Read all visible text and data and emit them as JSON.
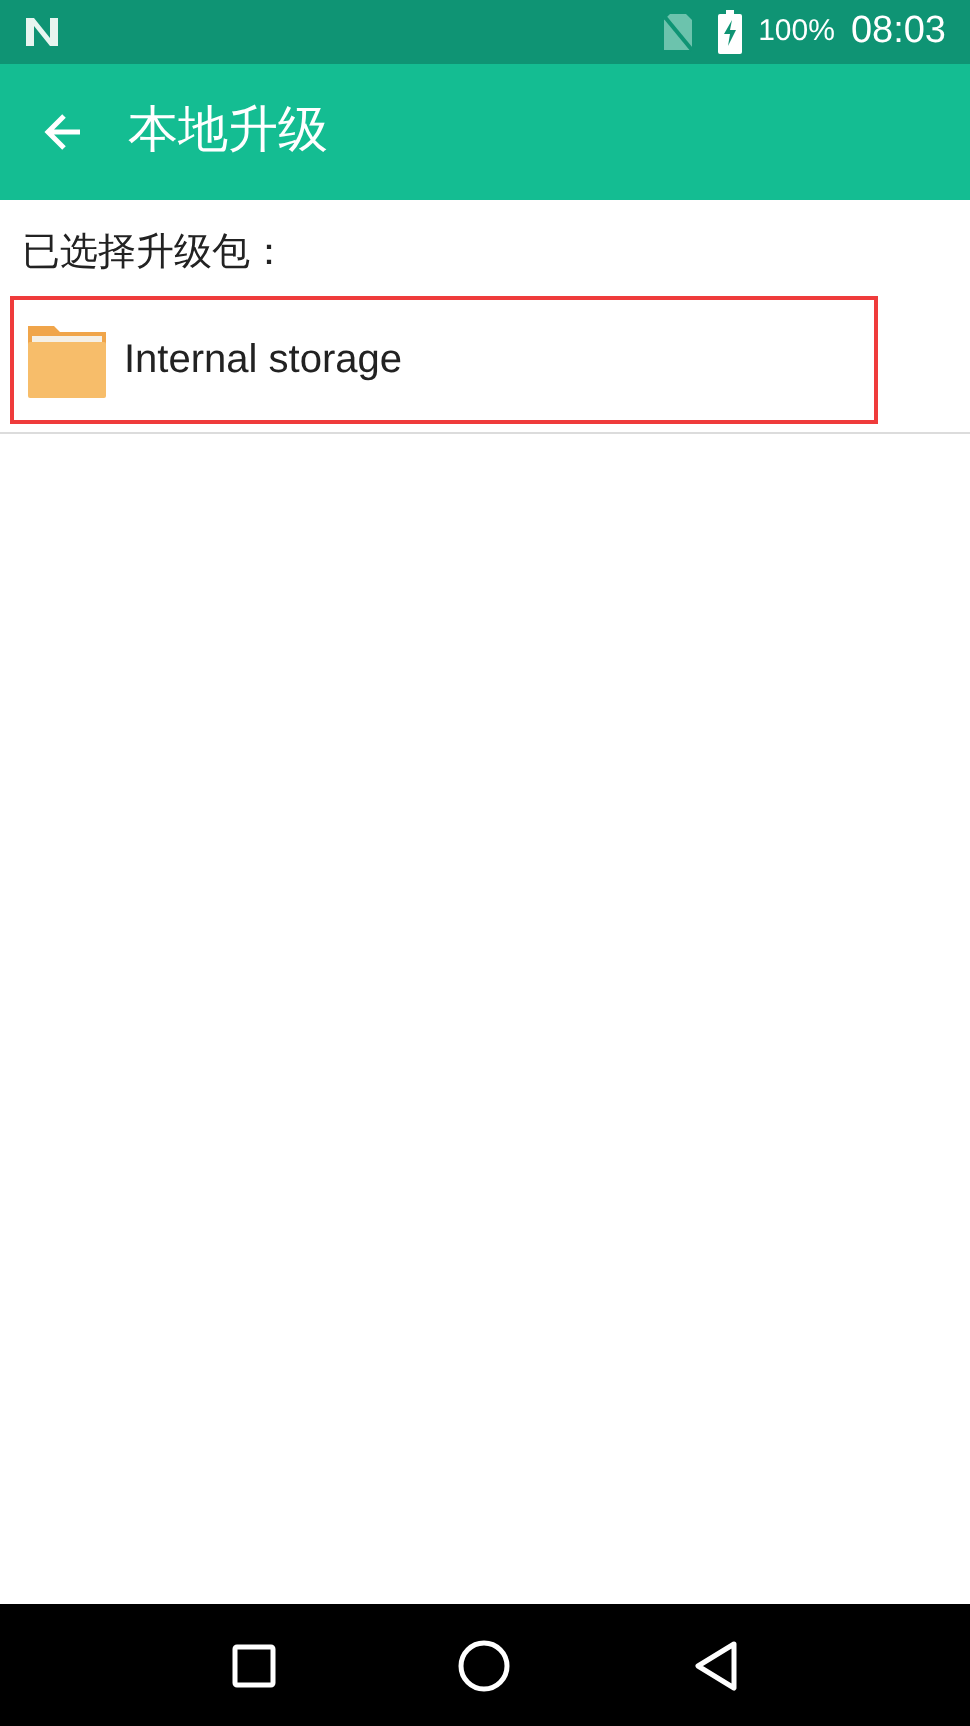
{
  "status_bar": {
    "battery": "100%",
    "time": "08:03"
  },
  "app_bar": {
    "title": "本地升级"
  },
  "section_label": "已选择升级包：",
  "items": [
    {
      "label": "Internal storage",
      "highlighted": true
    }
  ]
}
